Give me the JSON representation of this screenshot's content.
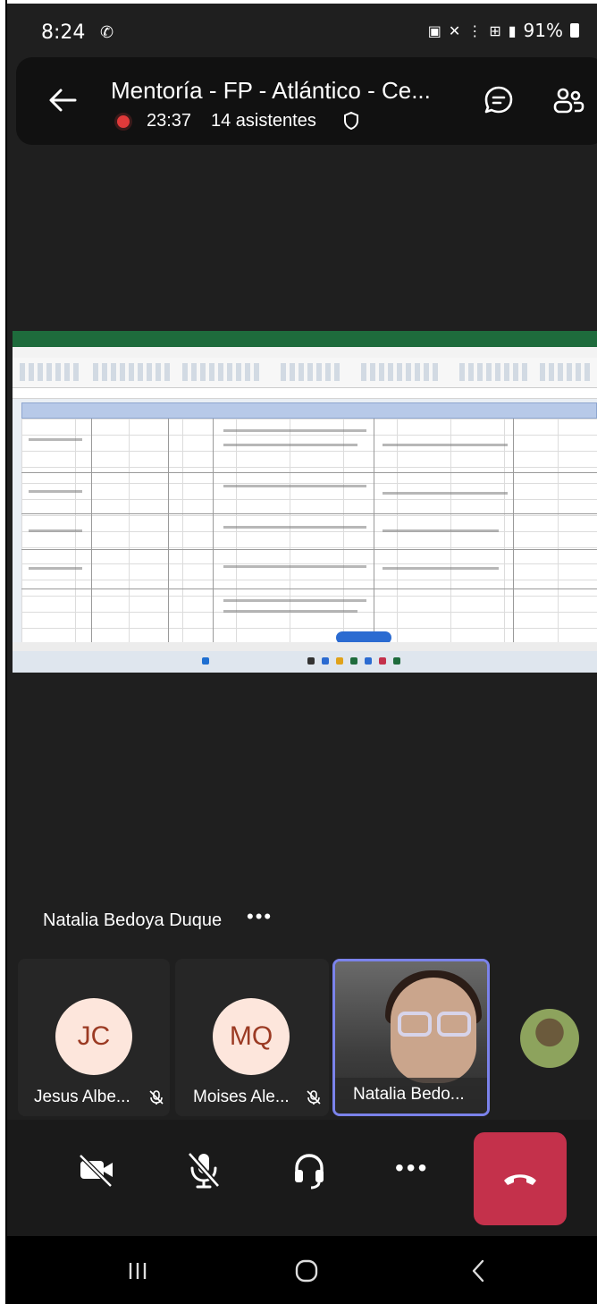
{
  "status_bar": {
    "time": "8:24",
    "battery": "91%"
  },
  "header": {
    "title": "Mentoría - FP - Atlántico - Ce...",
    "recording_time": "23:37",
    "attendees": "14 asistentes"
  },
  "presenter": {
    "name": "Natalia Bedoya Duque",
    "more": "•••"
  },
  "participants": [
    {
      "initials": "JC",
      "name": "Jesus Albe..."
    },
    {
      "initials": "MQ",
      "name": "Moises Ale..."
    },
    {
      "initials": "",
      "name": "Natalia Bedo..."
    }
  ],
  "controls": {
    "more": "•••"
  },
  "icons": {
    "back": "back-arrow-icon",
    "chat": "chat-icon",
    "people": "people-icon",
    "camera_off": "camera-off-icon",
    "mic_off": "mic-off-icon",
    "audio": "headset-icon",
    "hangup": "hang-up-icon"
  },
  "colors": {
    "background": "#1f1f1f",
    "recording": "#e03a3a",
    "active_speaker": "#7b83eb",
    "hangup": "#c4314b",
    "avatar_bg": "#fde6dc",
    "avatar_fg": "#9b3a23"
  }
}
